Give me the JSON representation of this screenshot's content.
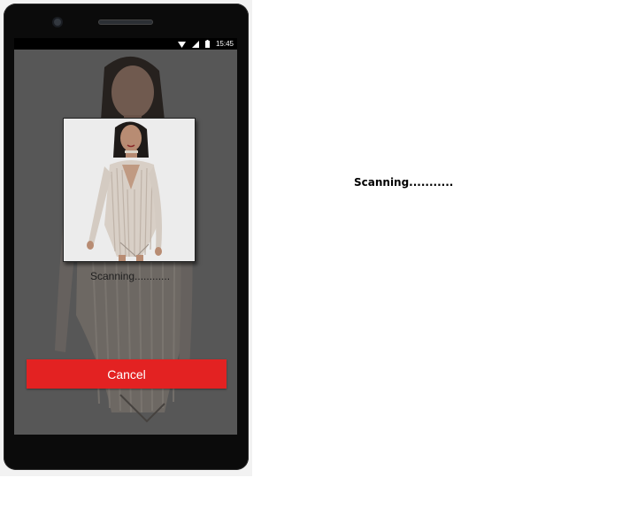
{
  "statusbar": {
    "time": "15:45",
    "icons": [
      "wifi-icon",
      "signal-icon",
      "battery-icon"
    ]
  },
  "scan_dialog": {
    "status_text": "Scanning............",
    "cancel_label": "Cancel"
  },
  "side_panel": {
    "status_text": "Scanning..........."
  },
  "colors": {
    "cancel_button": "#e32222",
    "screen_overlay": "#5b5b5b"
  }
}
